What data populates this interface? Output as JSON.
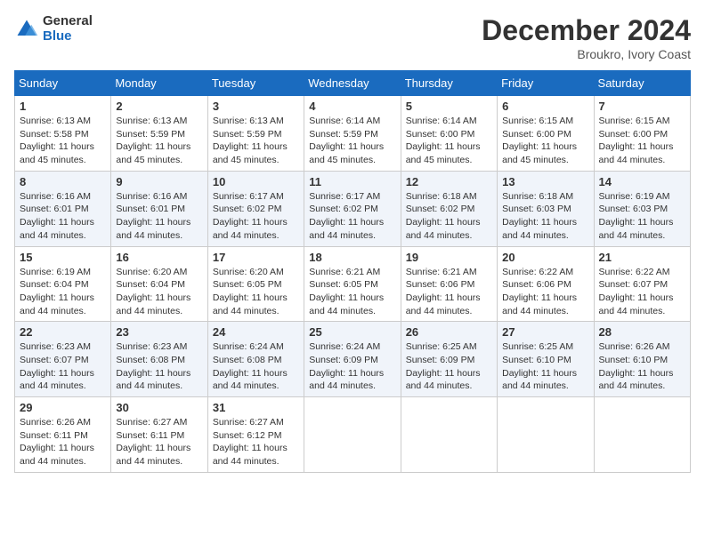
{
  "logo": {
    "general": "General",
    "blue": "Blue"
  },
  "header": {
    "month": "December 2024",
    "location": "Broukro, Ivory Coast"
  },
  "weekdays": [
    "Sunday",
    "Monday",
    "Tuesday",
    "Wednesday",
    "Thursday",
    "Friday",
    "Saturday"
  ],
  "weeks": [
    [
      {
        "day": "1",
        "sunrise": "6:13 AM",
        "sunset": "5:58 PM",
        "daylight": "11 hours and 45 minutes."
      },
      {
        "day": "2",
        "sunrise": "6:13 AM",
        "sunset": "5:59 PM",
        "daylight": "11 hours and 45 minutes."
      },
      {
        "day": "3",
        "sunrise": "6:13 AM",
        "sunset": "5:59 PM",
        "daylight": "11 hours and 45 minutes."
      },
      {
        "day": "4",
        "sunrise": "6:14 AM",
        "sunset": "5:59 PM",
        "daylight": "11 hours and 45 minutes."
      },
      {
        "day": "5",
        "sunrise": "6:14 AM",
        "sunset": "6:00 PM",
        "daylight": "11 hours and 45 minutes."
      },
      {
        "day": "6",
        "sunrise": "6:15 AM",
        "sunset": "6:00 PM",
        "daylight": "11 hours and 45 minutes."
      },
      {
        "day": "7",
        "sunrise": "6:15 AM",
        "sunset": "6:00 PM",
        "daylight": "11 hours and 44 minutes."
      }
    ],
    [
      {
        "day": "8",
        "sunrise": "6:16 AM",
        "sunset": "6:01 PM",
        "daylight": "11 hours and 44 minutes."
      },
      {
        "day": "9",
        "sunrise": "6:16 AM",
        "sunset": "6:01 PM",
        "daylight": "11 hours and 44 minutes."
      },
      {
        "day": "10",
        "sunrise": "6:17 AM",
        "sunset": "6:02 PM",
        "daylight": "11 hours and 44 minutes."
      },
      {
        "day": "11",
        "sunrise": "6:17 AM",
        "sunset": "6:02 PM",
        "daylight": "11 hours and 44 minutes."
      },
      {
        "day": "12",
        "sunrise": "6:18 AM",
        "sunset": "6:02 PM",
        "daylight": "11 hours and 44 minutes."
      },
      {
        "day": "13",
        "sunrise": "6:18 AM",
        "sunset": "6:03 PM",
        "daylight": "11 hours and 44 minutes."
      },
      {
        "day": "14",
        "sunrise": "6:19 AM",
        "sunset": "6:03 PM",
        "daylight": "11 hours and 44 minutes."
      }
    ],
    [
      {
        "day": "15",
        "sunrise": "6:19 AM",
        "sunset": "6:04 PM",
        "daylight": "11 hours and 44 minutes."
      },
      {
        "day": "16",
        "sunrise": "6:20 AM",
        "sunset": "6:04 PM",
        "daylight": "11 hours and 44 minutes."
      },
      {
        "day": "17",
        "sunrise": "6:20 AM",
        "sunset": "6:05 PM",
        "daylight": "11 hours and 44 minutes."
      },
      {
        "day": "18",
        "sunrise": "6:21 AM",
        "sunset": "6:05 PM",
        "daylight": "11 hours and 44 minutes."
      },
      {
        "day": "19",
        "sunrise": "6:21 AM",
        "sunset": "6:06 PM",
        "daylight": "11 hours and 44 minutes."
      },
      {
        "day": "20",
        "sunrise": "6:22 AM",
        "sunset": "6:06 PM",
        "daylight": "11 hours and 44 minutes."
      },
      {
        "day": "21",
        "sunrise": "6:22 AM",
        "sunset": "6:07 PM",
        "daylight": "11 hours and 44 minutes."
      }
    ],
    [
      {
        "day": "22",
        "sunrise": "6:23 AM",
        "sunset": "6:07 PM",
        "daylight": "11 hours and 44 minutes."
      },
      {
        "day": "23",
        "sunrise": "6:23 AM",
        "sunset": "6:08 PM",
        "daylight": "11 hours and 44 minutes."
      },
      {
        "day": "24",
        "sunrise": "6:24 AM",
        "sunset": "6:08 PM",
        "daylight": "11 hours and 44 minutes."
      },
      {
        "day": "25",
        "sunrise": "6:24 AM",
        "sunset": "6:09 PM",
        "daylight": "11 hours and 44 minutes."
      },
      {
        "day": "26",
        "sunrise": "6:25 AM",
        "sunset": "6:09 PM",
        "daylight": "11 hours and 44 minutes."
      },
      {
        "day": "27",
        "sunrise": "6:25 AM",
        "sunset": "6:10 PM",
        "daylight": "11 hours and 44 minutes."
      },
      {
        "day": "28",
        "sunrise": "6:26 AM",
        "sunset": "6:10 PM",
        "daylight": "11 hours and 44 minutes."
      }
    ],
    [
      {
        "day": "29",
        "sunrise": "6:26 AM",
        "sunset": "6:11 PM",
        "daylight": "11 hours and 44 minutes."
      },
      {
        "day": "30",
        "sunrise": "6:27 AM",
        "sunset": "6:11 PM",
        "daylight": "11 hours and 44 minutes."
      },
      {
        "day": "31",
        "sunrise": "6:27 AM",
        "sunset": "6:12 PM",
        "daylight": "11 hours and 44 minutes."
      },
      null,
      null,
      null,
      null
    ]
  ]
}
